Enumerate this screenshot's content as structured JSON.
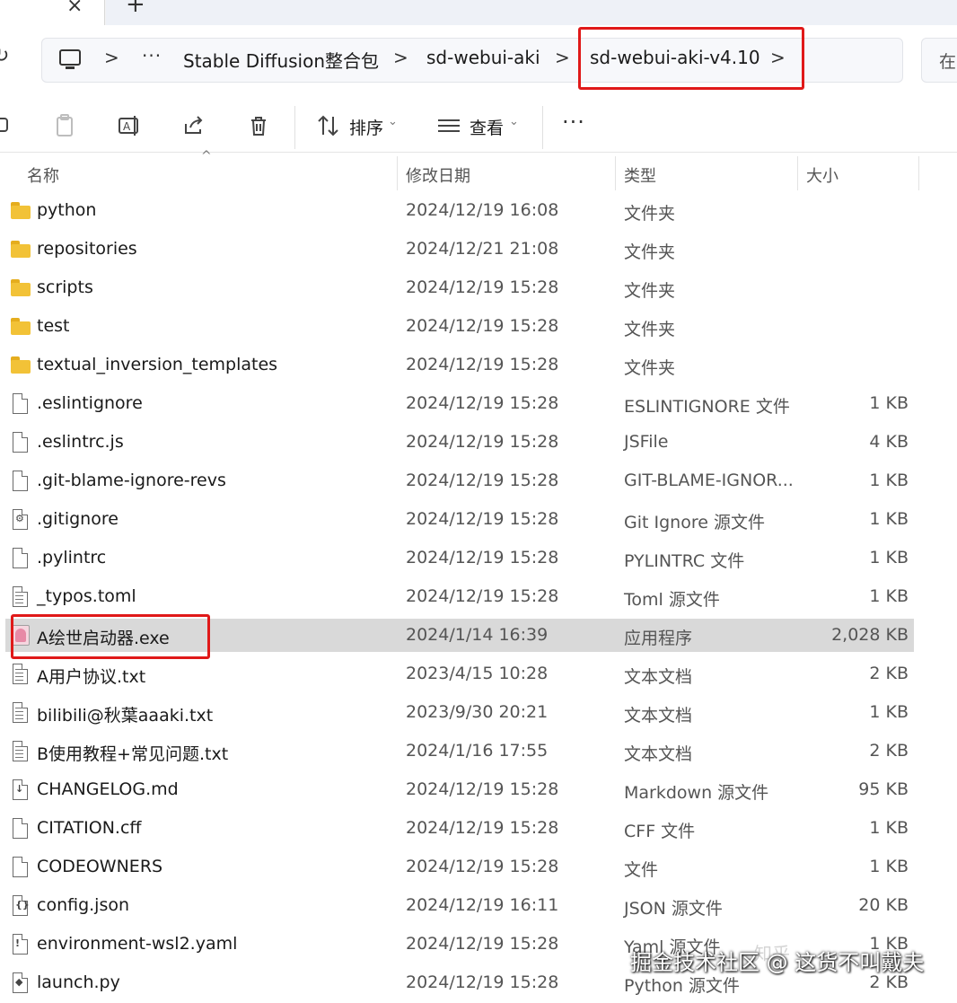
{
  "breadcrumb": {
    "ellipsis": "···",
    "items": [
      "Stable Diffusion整合包",
      "sd-webui-aki",
      "sd-webui-aki-v4.10"
    ],
    "separator": ">"
  },
  "search": {
    "placeholder_partial": "在"
  },
  "toolbar": {
    "sort_label": "排序",
    "view_label": "查看",
    "more_label": "···"
  },
  "columns": {
    "name": "名称",
    "date": "修改日期",
    "type": "类型",
    "size": "大小"
  },
  "files": [
    {
      "name": "python",
      "date": "2024/12/19 16:08",
      "type": "文件夹",
      "size": "",
      "icon": "folder-icon"
    },
    {
      "name": "repositories",
      "date": "2024/12/21 21:08",
      "type": "文件夹",
      "size": "",
      "icon": "folder-icon"
    },
    {
      "name": "scripts",
      "date": "2024/12/19 15:28",
      "type": "文件夹",
      "size": "",
      "icon": "folder-icon"
    },
    {
      "name": "test",
      "date": "2024/12/19 15:28",
      "type": "文件夹",
      "size": "",
      "icon": "folder-icon"
    },
    {
      "name": "textual_inversion_templates",
      "date": "2024/12/19 15:28",
      "type": "文件夹",
      "size": "",
      "icon": "folder-icon"
    },
    {
      "name": ".eslintignore",
      "date": "2024/12/19 15:28",
      "type": "ESLINTIGNORE 文件",
      "size": "1 KB",
      "icon": "file-icon"
    },
    {
      "name": ".eslintrc.js",
      "date": "2024/12/19 15:28",
      "type": "JSFile",
      "size": "4 KB",
      "icon": "file-icon"
    },
    {
      "name": ".git-blame-ignore-revs",
      "date": "2024/12/19 15:28",
      "type": "GIT-BLAME-IGNOR...",
      "size": "1 KB",
      "icon": "file-icon"
    },
    {
      "name": ".gitignore",
      "date": "2024/12/19 15:28",
      "type": "Git Ignore 源文件",
      "size": "1 KB",
      "icon": "gear-file-icon"
    },
    {
      "name": ".pylintrc",
      "date": "2024/12/19 15:28",
      "type": "PYLINTRC 文件",
      "size": "1 KB",
      "icon": "file-icon"
    },
    {
      "name": "_typos.toml",
      "date": "2024/12/19 15:28",
      "type": "Toml 源文件",
      "size": "1 KB",
      "icon": "text-file-icon"
    },
    {
      "name": "A绘世启动器.exe",
      "date": "2024/1/14 16:39",
      "type": "应用程序",
      "size": "2,028 KB",
      "icon": "app-exe-icon",
      "selected": true
    },
    {
      "name": "A用户协议.txt",
      "date": "2023/4/15 10:28",
      "type": "文本文档",
      "size": "2 KB",
      "icon": "text-file-icon"
    },
    {
      "name": "bilibili@秋葉aaaki.txt",
      "date": "2023/9/30 20:21",
      "type": "文本文档",
      "size": "1 KB",
      "icon": "text-file-icon"
    },
    {
      "name": "B使用教程+常见问题.txt",
      "date": "2024/1/16 17:55",
      "type": "文本文档",
      "size": "2 KB",
      "icon": "text-file-icon"
    },
    {
      "name": "CHANGELOG.md",
      "date": "2024/12/19 15:28",
      "type": "Markdown 源文件",
      "size": "95 KB",
      "icon": "markdown-file-icon"
    },
    {
      "name": "CITATION.cff",
      "date": "2024/12/19 15:28",
      "type": "CFF 文件",
      "size": "1 KB",
      "icon": "file-icon"
    },
    {
      "name": "CODEOWNERS",
      "date": "2024/12/19 15:28",
      "type": "文件",
      "size": "1 KB",
      "icon": "file-icon"
    },
    {
      "name": "config.json",
      "date": "2024/12/19 16:11",
      "type": "JSON 源文件",
      "size": "20 KB",
      "icon": "json-file-icon"
    },
    {
      "name": "environment-wsl2.yaml",
      "date": "2024/12/19 15:28",
      "type": "Yaml 源文件",
      "size": "1 KB",
      "icon": "yaml-file-icon"
    },
    {
      "name": "launch.py",
      "date": "2024/12/19 15:28",
      "type": "Python 源文件",
      "size": "2 KB",
      "icon": "python-file-icon"
    }
  ],
  "watermark": {
    "text": "掘金技术社区 @ 这货不叫戴夫",
    "faint": "知乎"
  },
  "colors": {
    "highlight": "#e01919",
    "folder": "#f2c237",
    "selected_row": "#d9d9d9"
  }
}
